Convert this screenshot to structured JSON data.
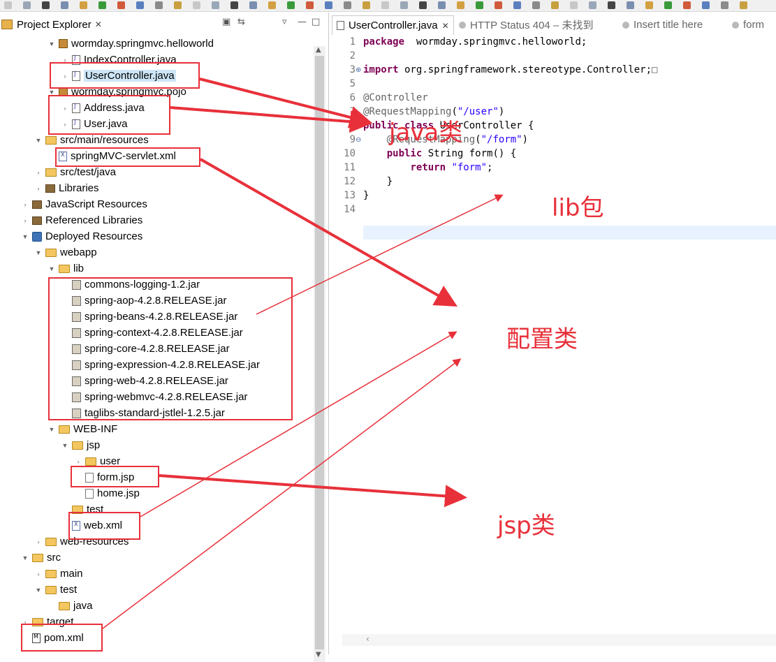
{
  "left_view": {
    "title": "Project Explorer",
    "close": "✕",
    "tools": [
      "▣",
      "⇆",
      "▿",
      "—",
      "□"
    ]
  },
  "tree_rows": [
    {
      "label": "wormday.springmvc.helloworld",
      "indent": 3,
      "twisty": "open",
      "icon": "pkg"
    },
    {
      "label": "IndexController.java",
      "indent": 4,
      "twisty": "closed",
      "icon": "java"
    },
    {
      "label": "UserController.java",
      "indent": 4,
      "twisty": "closed",
      "icon": "java",
      "selected": true
    },
    {
      "label": "wormday.springmvc.pojo",
      "indent": 3,
      "twisty": "open",
      "icon": "pkg"
    },
    {
      "label": "Address.java",
      "indent": 4,
      "twisty": "closed",
      "icon": "java"
    },
    {
      "label": "User.java",
      "indent": 4,
      "twisty": "closed",
      "icon": "java"
    },
    {
      "label": "src/main/resources",
      "indent": 2,
      "twisty": "open",
      "icon": "srcf"
    },
    {
      "label": "springMVC-servlet.xml",
      "indent": 3,
      "twisty": "none",
      "icon": "xml"
    },
    {
      "label": "src/test/java",
      "indent": 2,
      "twisty": "closed",
      "icon": "srcf"
    },
    {
      "label": "Libraries",
      "indent": 2,
      "twisty": "closed",
      "icon": "lib"
    },
    {
      "label": "JavaScript Resources",
      "indent": 1,
      "twisty": "closed",
      "icon": "lib"
    },
    {
      "label": "Referenced Libraries",
      "indent": 1,
      "twisty": "closed",
      "icon": "lib"
    },
    {
      "label": "Deployed Resources",
      "indent": 1,
      "twisty": "open",
      "icon": "res"
    },
    {
      "label": "webapp",
      "indent": 2,
      "twisty": "open",
      "icon": "folder"
    },
    {
      "label": "lib",
      "indent": 3,
      "twisty": "open",
      "icon": "folder"
    },
    {
      "label": "commons-logging-1.2.jar",
      "indent": 4,
      "twisty": "none",
      "icon": "jar"
    },
    {
      "label": "spring-aop-4.2.8.RELEASE.jar",
      "indent": 4,
      "twisty": "none",
      "icon": "jar"
    },
    {
      "label": "spring-beans-4.2.8.RELEASE.jar",
      "indent": 4,
      "twisty": "none",
      "icon": "jar"
    },
    {
      "label": "spring-context-4.2.8.RELEASE.jar",
      "indent": 4,
      "twisty": "none",
      "icon": "jar"
    },
    {
      "label": "spring-core-4.2.8.RELEASE.jar",
      "indent": 4,
      "twisty": "none",
      "icon": "jar"
    },
    {
      "label": "spring-expression-4.2.8.RELEASE.jar",
      "indent": 4,
      "twisty": "none",
      "icon": "jar"
    },
    {
      "label": "spring-web-4.2.8.RELEASE.jar",
      "indent": 4,
      "twisty": "none",
      "icon": "jar"
    },
    {
      "label": "spring-webmvc-4.2.8.RELEASE.jar",
      "indent": 4,
      "twisty": "none",
      "icon": "jar"
    },
    {
      "label": "taglibs-standard-jstlel-1.2.5.jar",
      "indent": 4,
      "twisty": "none",
      "icon": "jar"
    },
    {
      "label": "WEB-INF",
      "indent": 3,
      "twisty": "open",
      "icon": "folder"
    },
    {
      "label": "jsp",
      "indent": 4,
      "twisty": "open",
      "icon": "folder"
    },
    {
      "label": "user",
      "indent": 5,
      "twisty": "closed",
      "icon": "folder"
    },
    {
      "label": "form.jsp",
      "indent": 5,
      "twisty": "none",
      "icon": "jsp"
    },
    {
      "label": "home.jsp",
      "indent": 5,
      "twisty": "none",
      "icon": "jsp"
    },
    {
      "label": "test",
      "indent": 4,
      "twisty": "none",
      "icon": "folder"
    },
    {
      "label": "web.xml",
      "indent": 4,
      "twisty": "none",
      "icon": "xml"
    },
    {
      "label": "web-resources",
      "indent": 2,
      "twisty": "closed",
      "icon": "folder"
    },
    {
      "label": "src",
      "indent": 1,
      "twisty": "open",
      "icon": "folder"
    },
    {
      "label": "main",
      "indent": 2,
      "twisty": "closed",
      "icon": "folder"
    },
    {
      "label": "test",
      "indent": 2,
      "twisty": "open",
      "icon": "folder"
    },
    {
      "label": "java",
      "indent": 3,
      "twisty": "none",
      "icon": "folder"
    },
    {
      "label": "target",
      "indent": 1,
      "twisty": "closed",
      "icon": "folder"
    },
    {
      "label": "pom.xml",
      "indent": 1,
      "twisty": "none",
      "icon": "pom"
    }
  ],
  "editor_tabs": [
    {
      "label": "UserController.java",
      "active": true,
      "close": "✕"
    },
    {
      "label": "HTTP Status 404 – 未找到",
      "active": false
    },
    {
      "label": "Insert title here",
      "active": false
    },
    {
      "label": "form",
      "active": false
    }
  ],
  "code_lines": [
    {
      "n": "1",
      "parts": [
        [
          "kw",
          "package"
        ],
        [
          "",
          "  wormday.springmvc.helloworld;"
        ]
      ]
    },
    {
      "n": "2",
      "parts": []
    },
    {
      "n": "3",
      "marker": "⊕",
      "parts": [
        [
          "kw",
          "import"
        ],
        [
          "",
          " org.springframework.stereotype.Controller;"
        ],
        [
          "ann",
          "□"
        ]
      ]
    },
    {
      "n": "5",
      "parts": []
    },
    {
      "n": "6",
      "parts": [
        [
          "ann",
          "@Controller"
        ]
      ]
    },
    {
      "n": "7",
      "parts": [
        [
          "ann",
          "@RequestMapping"
        ],
        [
          "",
          "("
        ],
        [
          "str",
          "\"/user\""
        ],
        [
          "",
          ")"
        ]
      ]
    },
    {
      "n": "8",
      "parts": [
        [
          "kw",
          "public"
        ],
        [
          "",
          " "
        ],
        [
          "kw",
          "class"
        ],
        [
          "",
          " UserController {"
        ]
      ]
    },
    {
      "n": "9",
      "marker": "⊖",
      "parts": [
        [
          "",
          "    "
        ],
        [
          "ann",
          "@RequestMapping"
        ],
        [
          "",
          "("
        ],
        [
          "str",
          "\"/form\""
        ],
        [
          "",
          ")"
        ]
      ]
    },
    {
      "n": "10",
      "parts": [
        [
          "",
          "    "
        ],
        [
          "kw",
          "public"
        ],
        [
          "",
          " String form() {"
        ]
      ]
    },
    {
      "n": "11",
      "parts": [
        [
          "",
          "        "
        ],
        [
          "kw",
          "return"
        ],
        [
          "",
          " "
        ],
        [
          "str",
          "\"form\""
        ],
        [
          "",
          ";"
        ]
      ]
    },
    {
      "n": "12",
      "parts": [
        [
          "",
          "    }"
        ]
      ]
    },
    {
      "n": "13",
      "parts": [
        [
          "",
          "}"
        ]
      ]
    },
    {
      "n": "14",
      "parts": []
    }
  ],
  "annotations": {
    "java": "java类",
    "lib": "lib包",
    "config": "配置类",
    "jsp": "jsp类"
  },
  "colors": {
    "annotation_red": "#e8303a",
    "keyword": "#7f0055",
    "string": "#2a00ff",
    "selection": "#cde6f7"
  }
}
